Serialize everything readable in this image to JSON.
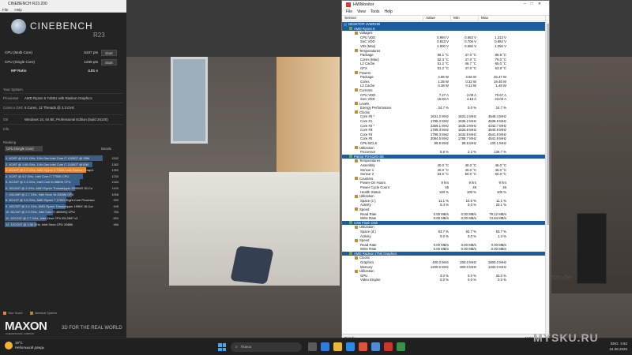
{
  "cinebench": {
    "window_title": "CINEBENCH R23.200",
    "menu": [
      "File",
      "Help"
    ],
    "app_name": "CINEBENCH",
    "version": "R23",
    "scores": [
      {
        "label": "CPU (Multi Core)",
        "value": "6107 pts",
        "button": "Start"
      },
      {
        "label": "CPU (Single Core)",
        "value": "1269 pts",
        "button": "Start"
      },
      {
        "label": "MP Ratio",
        "value": "4.81 x"
      }
    ],
    "system_header": "Your System",
    "system": [
      {
        "k": "Processor",
        "v": "AMD Ryzen 5 7430U with Radeon Graphics"
      },
      {
        "k": "Cores x GHz",
        "v": "6 Cores, 12 Threads @ 2.3 GHz"
      },
      {
        "k": "OS",
        "v": "Windows 10, 64 Bit, Professional Edition (build 26100)"
      },
      {
        "k": "Info",
        "v": ""
      }
    ],
    "ranking_header": "Ranking",
    "ranking_select": "CPU (Single Core)",
    "details_label": "Details",
    "ranking": [
      {
        "label": "1. 4C/8T @ 2.61 GHz, 11th Gen Intel Core i7-1165G7 @ 28W",
        "score": "1532",
        "pct": 1.0
      },
      {
        "label": "2. 4C/8T @ 1.69 GHz, 11th Gen Intel Core i7-1165G7 @15W",
        "score": "1382",
        "pct": 0.9
      },
      {
        "label": "3. 6C/12T @ 2.3 GHz, AMD Ryzen 5 7430U with Radeon Graphi",
        "score": "1269",
        "pct": 0.83
      },
      {
        "label": "4. 4C/8T @ 4.2 GHz, Intel Core i7-7700K CPU",
        "score": "1230",
        "pct": 0.8
      },
      {
        "label": "5. 8C/16T @ 2.3 GHz, Intel Core i9-9880H CPU",
        "score": "1183",
        "pct": 0.77
      },
      {
        "label": "6. 32C/64T @ 3 GHz, AMD Ryzen Threadripper 2990WX 32-Co",
        "score": "1109",
        "pct": 0.72
      },
      {
        "label": "7. 24C/48T @ 2.7 GHz, Intel Xeon W-3265M CPU",
        "score": "1058",
        "pct": 0.69
      },
      {
        "label": "8. 6C/12T @ 3.5 GHz, AMD Ryzen 7 1700X Eight-Core Processo",
        "score": "959",
        "pct": 0.63
      },
      {
        "label": "9. 16C/32T @ 3.4 GHz, AMD Ryzen Threadripper 1950X 16-Cor",
        "score": "945",
        "pct": 0.62
      },
      {
        "label": "10. 8C/16T @ 2.9 GHz, Intel Core i7-4850HQ CPU",
        "score": "750",
        "pct": 0.49
      },
      {
        "label": "11. 12C/24T @ 2.7 GHz, Intel Xeon CPU E5-2697 v2",
        "score": "653",
        "pct": 0.43
      },
      {
        "label": "12. 12C/24T @ 2.66 GHz, Intel Xeon CPU X5650",
        "score": "486",
        "pct": 0.32
      }
    ],
    "legend_your": "Your Score",
    "legend_identical": "Identical System",
    "brand": "MAXON",
    "brand_sub": "A NEMETSCHEK COMPANY",
    "tagline": "3D FOR THE REAL WORLD",
    "colors": {
      "your": "#e8882a",
      "identical": "#b5843a",
      "bar": "#3b5e86"
    }
  },
  "hwmonitor": {
    "title": "HWMonitor",
    "menu": [
      "File",
      "View",
      "Tools",
      "Help"
    ],
    "columns": [
      "Sensor",
      "Value",
      "Min",
      "Max"
    ],
    "status": "Ready",
    "numlock": "NUM",
    "rows": [
      {
        "t": "dev",
        "n": "DESKTOP-JVMRH0I",
        "i": 0
      },
      {
        "t": "dev",
        "n": "AMD Ryzen 5",
        "i": 1
      },
      {
        "t": "grp",
        "n": "Voltages",
        "i": 2
      },
      {
        "n": "CPU VDD",
        "v": "0.994 V",
        "mi": "0.663 V",
        "ma": "1.313 V",
        "i": 3
      },
      {
        "n": "SoC VDD",
        "v": "0.813 V",
        "mi": "0.706 V",
        "ma": "0.862 V",
        "i": 3
      },
      {
        "n": "VID (Max)",
        "v": "1.000 V",
        "mi": "0.656 V",
        "ma": "1.256 V",
        "i": 3
      },
      {
        "t": "grp",
        "n": "Temperatures",
        "i": 2
      },
      {
        "n": "Package",
        "v": "56.1 °C",
        "mi": "47.0 °C",
        "ma": "86.8 °C",
        "i": 3
      },
      {
        "n": "Cores (Max)",
        "v": "52.3 °C",
        "mi": "47.0 °C",
        "ma": "79.0 °C",
        "i": 3
      },
      {
        "n": "L2 Cache",
        "v": "51.2 °C",
        "mi": "46.7 °C",
        "ma": "65.0 °C",
        "i": 3
      },
      {
        "n": "GFX",
        "v": "51.2 °C",
        "mi": "47.0 °C",
        "ma": "63.8 °C",
        "i": 3
      },
      {
        "t": "grp",
        "n": "Powers",
        "i": 2
      },
      {
        "n": "Package",
        "v": "4.86 W",
        "mi": "3.66 W",
        "ma": "25.47 W",
        "i": 3
      },
      {
        "n": "Cores",
        "v": "1.35 W",
        "mi": "0.32 W",
        "ma": "19.46 W",
        "i": 3
      },
      {
        "n": "L2 Cache",
        "v": "0.38 W",
        "mi": "0.12 W",
        "ma": "1.48 W",
        "i": 3
      },
      {
        "t": "grp",
        "n": "Currents",
        "i": 2
      },
      {
        "n": "CPU VDD",
        "v": "7.27 A",
        "mi": "2.08 A",
        "ma": "70.67 A",
        "i": 3
      },
      {
        "n": "SoC VDD",
        "v": "16.83 A",
        "mi": "4.16 A",
        "ma": "43.03 A",
        "i": 3
      },
      {
        "t": "grp",
        "n": "Levels",
        "i": 2
      },
      {
        "n": "Energy Performance",
        "v": "24.7 %",
        "mi": "0.0 %",
        "ma": "24.7 %",
        "i": 3
      },
      {
        "t": "grp",
        "n": "Clocks",
        "i": 2
      },
      {
        "n": "Core #0 *",
        "v": "1631.2 MHz",
        "mi": "1631.2 MHz",
        "ma": "4548.4 MHz",
        "i": 3
      },
      {
        "n": "Core #1",
        "v": "1799.3 MHz",
        "mi": "1636.2 MHz",
        "ma": "4539.9 MHz",
        "i": 3
      },
      {
        "n": "Core #2 *",
        "v": "2359.1 MHz",
        "mi": "1636.3 MHz",
        "ma": "4342.7 MHz",
        "i": 3
      },
      {
        "n": "Core #3",
        "v": "1799.3 MHz",
        "mi": "1634.9 MHz",
        "ma": "4540.9 MHz",
        "i": 3
      },
      {
        "n": "Core #4",
        "v": "1799.3 MHz",
        "mi": "1632.8 MHz",
        "ma": "4541.8 MHz",
        "i": 3
      },
      {
        "n": "Core #5",
        "v": "3084.5 MHz",
        "mi": "1788.7 MHz",
        "ma": "4541.9 MHz",
        "i": 3
      },
      {
        "n": "CPU BCLK",
        "v": "99.9 MHz",
        "mi": "99.8 MHz",
        "ma": "100.1 MHz",
        "i": 3
      },
      {
        "t": "grp",
        "n": "Utilization",
        "i": 2
      },
      {
        "n": "Processor",
        "v": "6.8 %",
        "mi": "2.2 %",
        "ma": "136.7 %",
        "i": 3
      },
      {
        "t": "dev",
        "n": "Patriot P3-512G-SE",
        "i": 1
      },
      {
        "t": "grp",
        "n": "Temperatures",
        "i": 2
      },
      {
        "n": "Assembly",
        "v": "40.0 °C",
        "mi": "40.0 °C",
        "ma": "46.0 °C",
        "i": 3
      },
      {
        "n": "Sensor 1",
        "v": "40.0 °C",
        "mi": "40.0 °C",
        "ma": "46.0 °C",
        "i": 3
      },
      {
        "n": "Sensor 2",
        "v": "53.0 °C",
        "mi": "50.0 °C",
        "ma": "60.0 °C",
        "i": 3
      },
      {
        "t": "grp",
        "n": "Counters",
        "i": 2
      },
      {
        "n": "Power-On Hours",
        "v": "9 hrs",
        "mi": "9 hrs",
        "ma": "9 hrs",
        "i": 3
      },
      {
        "n": "Power Cycle Count",
        "v": "46",
        "mi": "46",
        "ma": "46",
        "i": 3
      },
      {
        "n": "Health Status",
        "v": "100 %",
        "mi": "100 %",
        "ma": "100 %",
        "i": 3
      },
      {
        "t": "grp",
        "n": "Utilization",
        "i": 2
      },
      {
        "n": "Space (c:)",
        "v": "11.1 %",
        "mi": "10.6 %",
        "ma": "11.1 %",
        "i": 3
      },
      {
        "n": "Activity",
        "v": "0.4 %",
        "mi": "0.0 %",
        "ma": "20.1 %",
        "i": 3
      },
      {
        "t": "grp",
        "n": "Speed",
        "i": 2
      },
      {
        "n": "Read Rate",
        "v": "0.00 MB/s",
        "mi": "0.00 MB/s",
        "ma": "79.12 MB/s",
        "i": 3
      },
      {
        "n": "Write Rate",
        "v": "0.00 MB/s",
        "mi": "0.00 MB/s",
        "ma": "74.84 MB/s",
        "i": 3
      },
      {
        "t": "dev",
        "n": "USB  Flash Disk",
        "i": 1
      },
      {
        "t": "grp",
        "n": "Utilization",
        "i": 2
      },
      {
        "n": "Space (d:)",
        "v": "53.7 %",
        "mi": "53.7 %",
        "ma": "53.7 %",
        "i": 3
      },
      {
        "n": "Activity",
        "v": "0.0 %",
        "mi": "0.0 %",
        "ma": "1.3 %",
        "i": 3
      },
      {
        "t": "grp",
        "n": "Speed",
        "i": 2
      },
      {
        "n": "Read Rate",
        "v": "0.00 MB/s",
        "mi": "0.00 MB/s",
        "ma": "0.00 MB/s",
        "i": 3
      },
      {
        "n": "Write Rate",
        "v": "0.00 MB/s",
        "mi": "0.00 MB/s",
        "ma": "0.00 MB/s",
        "i": 3
      },
      {
        "t": "dev",
        "n": "AMD Radeon (TM) Graphics",
        "i": 1
      },
      {
        "t": "grp",
        "n": "Clocks",
        "i": 2
      },
      {
        "n": "Graphics",
        "v": "400.0 MHz",
        "mi": "200.0 MHz",
        "ma": "1800.0 MHz",
        "i": 3
      },
      {
        "n": "Memory",
        "v": "1200.0 MHz",
        "mi": "800.0 MHz",
        "ma": "1333.0 MHz",
        "i": 3
      },
      {
        "t": "grp",
        "n": "Utilization",
        "i": 2
      },
      {
        "n": "GPU",
        "v": "3.0 %",
        "mi": "0.0 %",
        "ma": "33.0 %",
        "i": 3
      },
      {
        "n": "Video Engine",
        "v": "0.0 %",
        "mi": "0.0 %",
        "ma": "0.0 %",
        "i": 3
      }
    ]
  },
  "wallpaper": {
    "watermark": "ron.de"
  },
  "taskbar": {
    "weather_temp": "19°C",
    "weather_desc": "Небольшой дождь",
    "search_placeholder": "Поиск",
    "lang": "ENG",
    "time": "4:52",
    "date": "24.08.2025",
    "site": "MYSKU.RU"
  }
}
